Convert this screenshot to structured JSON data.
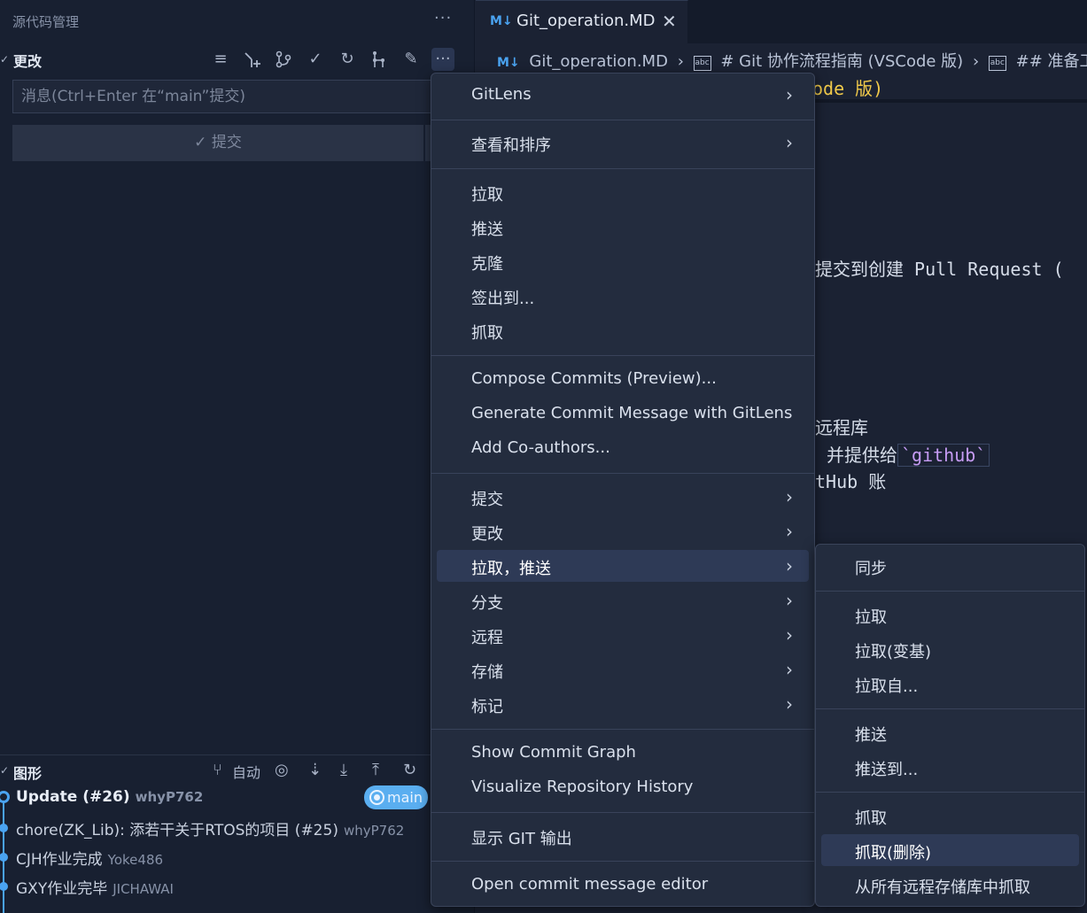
{
  "sidebar": {
    "title": "源代码管理",
    "more": "···",
    "changes_section": "更改",
    "message_placeholder": "消息(Ctrl+Enter 在“main”提交)",
    "commit_label": "✓ 提交",
    "graph_section": "图形",
    "graph_auto": "自动",
    "commits": [
      {
        "message": "Update (#26)",
        "author": "whyP762"
      },
      {
        "message": "chore(ZK_Lib): 添若干关于RTOS的项目 (#25)",
        "author": "whyP762"
      },
      {
        "message": "CJH作业完成",
        "author": "Yoke486"
      },
      {
        "message": "GXY作业完毕",
        "author": "JICHAWAI"
      }
    ],
    "branch_badge": "main"
  },
  "editor": {
    "tab_label": "Git_operation.MD",
    "breadcrumb": {
      "file": "Git_operation.MD",
      "h1": "# Git 协作流程指南 (VSCode 版)",
      "h2": "## 准备工作"
    },
    "code_fragments": {
      "title_tail": "ode 版)",
      "line_pr": "提交到创建 Pull Request (",
      "line_remote": "远程库",
      "line_provide_a": "、并提供给",
      "line_provide_code": "`github`",
      "line_account": "tHub 账"
    }
  },
  "context_menu": {
    "groups": [
      [
        {
          "label": "GitLens",
          "submenu": true
        }
      ],
      [
        {
          "label": "查看和排序",
          "submenu": true
        }
      ],
      [
        {
          "label": "拉取"
        },
        {
          "label": "推送"
        },
        {
          "label": "克隆"
        },
        {
          "label": "签出到..."
        },
        {
          "label": "抓取"
        }
      ],
      [
        {
          "label": "Compose Commits (Preview)..."
        },
        {
          "label": "Generate Commit Message with GitLens"
        },
        {
          "label": "Add Co-authors..."
        }
      ],
      [
        {
          "label": "提交",
          "submenu": true
        },
        {
          "label": "更改",
          "submenu": true
        },
        {
          "label": "拉取，推送",
          "submenu": true
        },
        {
          "label": "分支",
          "submenu": true
        },
        {
          "label": "远程",
          "submenu": true
        },
        {
          "label": "存储",
          "submenu": true
        },
        {
          "label": "标记",
          "submenu": true
        }
      ],
      [
        {
          "label": "Show Commit Graph"
        },
        {
          "label": "Visualize Repository History"
        }
      ],
      [
        {
          "label": "显示 GIT 输出"
        }
      ],
      [
        {
          "label": "Open commit message editor"
        }
      ]
    ]
  },
  "submenu": {
    "items": [
      "同步",
      "拉取",
      "拉取(变基)",
      "拉取自...",
      "推送",
      "推送到...",
      "抓取",
      "抓取(删除)",
      "从所有远程存储库中抓取"
    ]
  },
  "colors": {
    "accent": "#4aa3f0",
    "menu_bg": "#232c3e",
    "hover": "#2e3a56"
  }
}
